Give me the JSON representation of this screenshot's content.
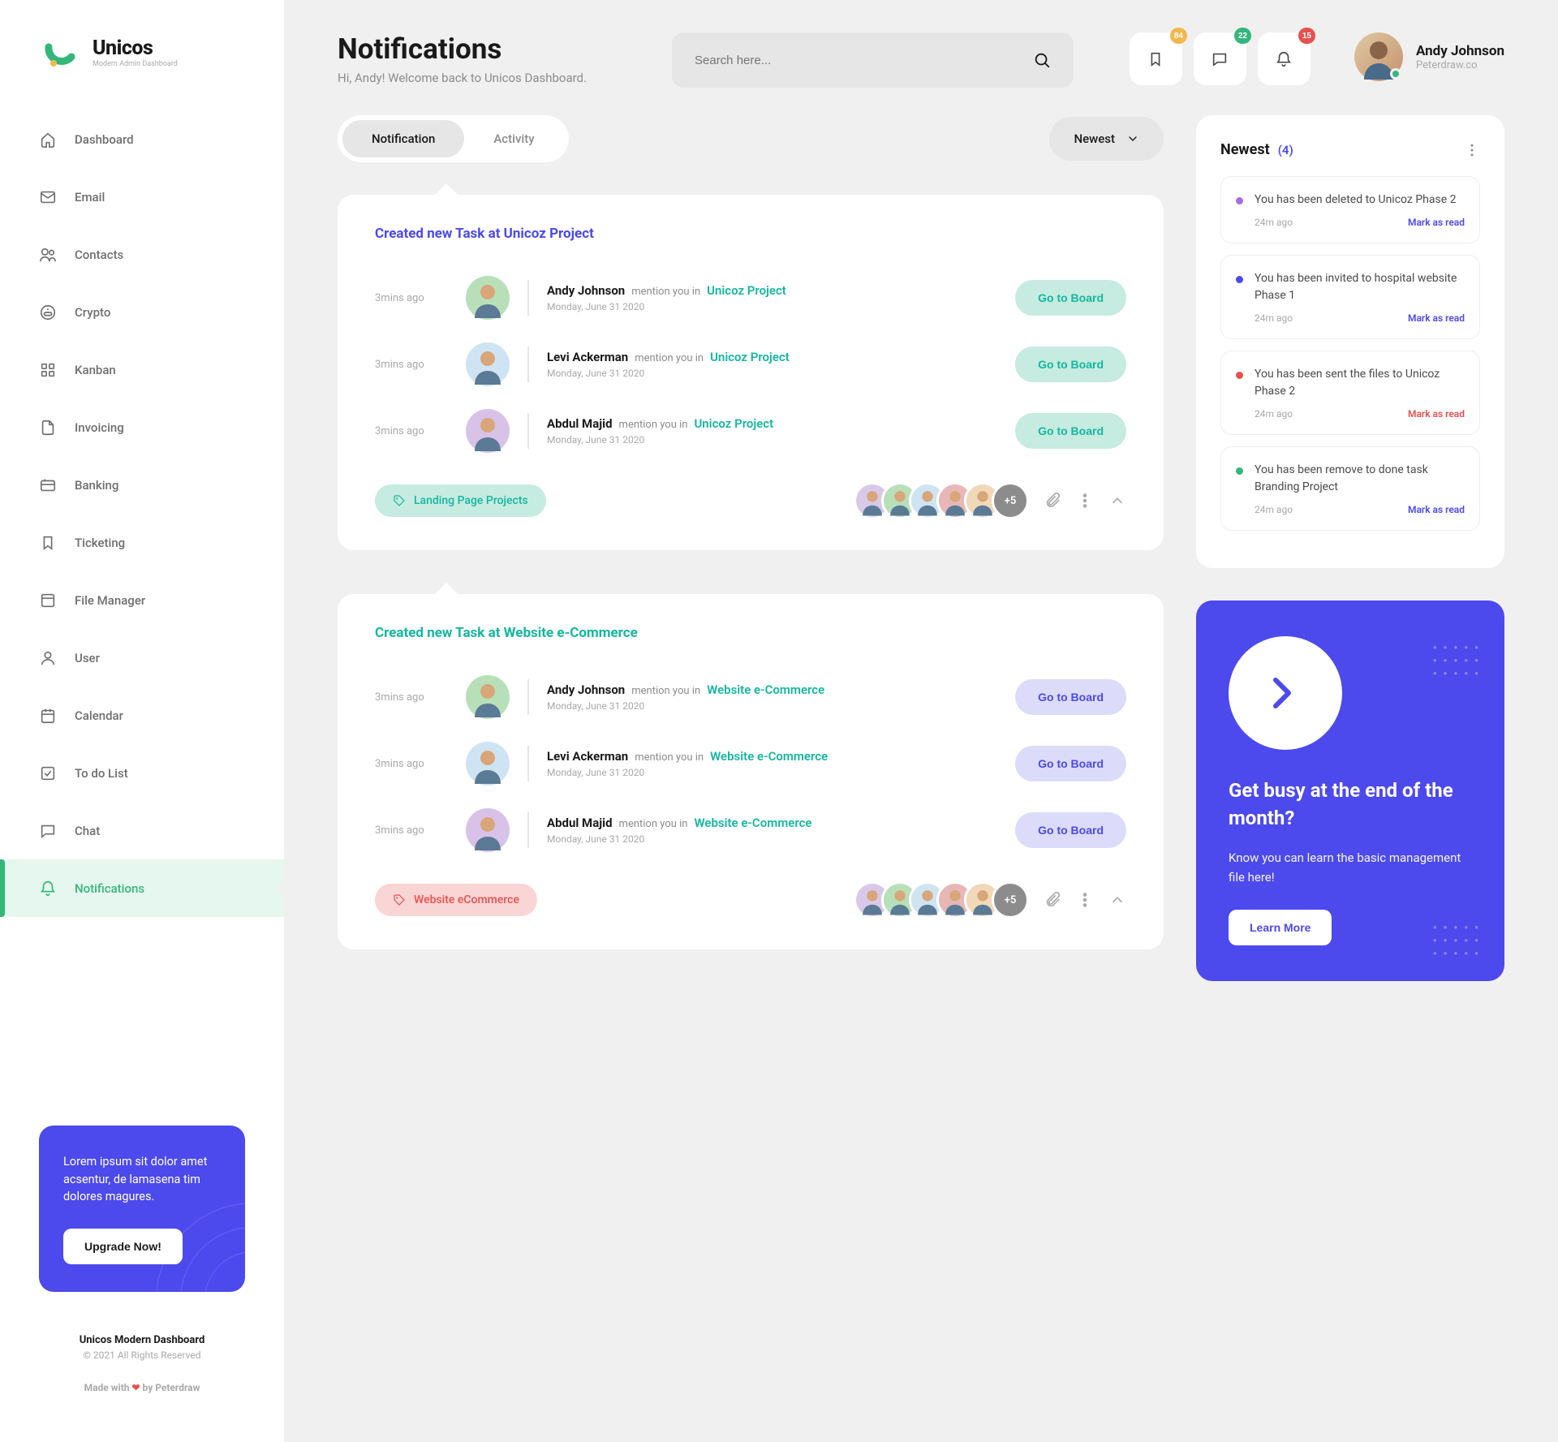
{
  "brand": {
    "name": "Unicos",
    "tagline": "Modern Admin Dashboard"
  },
  "header": {
    "title": "Notifications",
    "subtitle": "Hi, Andy! Welcome back to Unicos Dashboard.",
    "search_placeholder": "Search here..."
  },
  "badges": {
    "bookmark": "84",
    "chat": "22",
    "bell": "15"
  },
  "badge_colors": {
    "bookmark": "#F2B84B",
    "chat": "#33B77A",
    "bell": "#E94F4F"
  },
  "user": {
    "name": "Andy Johnson",
    "company": "Peterdraw.co"
  },
  "nav": [
    {
      "label": "Dashboard"
    },
    {
      "label": "Email"
    },
    {
      "label": "Contacts"
    },
    {
      "label": "Crypto"
    },
    {
      "label": "Kanban"
    },
    {
      "label": "Invoicing"
    },
    {
      "label": "Banking"
    },
    {
      "label": "Ticketing"
    },
    {
      "label": "File Manager"
    },
    {
      "label": "User"
    },
    {
      "label": "Calendar"
    },
    {
      "label": "To do List"
    },
    {
      "label": "Chat"
    },
    {
      "label": "Notifications"
    }
  ],
  "promo": {
    "text": "Lorem ipsum sit dolor amet acsentur, de lamasena tim dolores magures.",
    "button": "Upgrade Now!"
  },
  "footer": {
    "line1": "Unicos Modern Dashboard",
    "line2": "© 2021 All Rights Reserved",
    "made_pre": "Made with ",
    "made_post": " by Peterdraw"
  },
  "tabs": {
    "a": "Notification",
    "b": "Activity",
    "sort": "Newest"
  },
  "cards": [
    {
      "title": "Created new Task at Unicoz Project",
      "title_class": "",
      "tag": "Landing Page Projects",
      "tag_class": "teal",
      "btn_class": "teal",
      "proj_color": "#15B79E",
      "more_label": "+5",
      "rows": [
        {
          "time": "3mins ago",
          "name": "Andy Johnson",
          "mention": "mention you in",
          "project": "Unicoz Project",
          "date": "Monday, June 31 2020",
          "button": "Go to Board",
          "ava_bg": "#B7E0B8"
        },
        {
          "time": "3mins ago",
          "name": "Levi Ackerman",
          "mention": "mention you in",
          "project": "Unicoz Project",
          "date": "Monday, June 31 2020",
          "button": "Go to Board",
          "ava_bg": "#CFE4F2"
        },
        {
          "time": "3mins ago",
          "name": "Abdul Majid",
          "mention": "mention you in",
          "project": "Unicoz Project",
          "date": "Monday, June 31 2020",
          "button": "Go to Board",
          "ava_bg": "#D9C2E8"
        }
      ]
    },
    {
      "title": "Created new Task at Website e-Commerce",
      "title_class": "green",
      "tag": "Website eCommerce",
      "tag_class": "red",
      "btn_class": "purple",
      "proj_color": "#15B79E",
      "more_label": "+5",
      "rows": [
        {
          "time": "3mins ago",
          "name": "Andy Johnson",
          "mention": "mention you in",
          "project": "Website e-Commerce",
          "date": "Monday, June 31 2020",
          "button": "Go to Board",
          "ava_bg": "#B7E0B8"
        },
        {
          "time": "3mins ago",
          "name": "Levi Ackerman",
          "mention": "mention you in",
          "project": "Website e-Commerce",
          "date": "Monday, June 31 2020",
          "button": "Go to Board",
          "ava_bg": "#CFE4F2"
        },
        {
          "time": "3mins ago",
          "name": "Abdul Majid",
          "mention": "mention you in",
          "project": "Website e-Commerce",
          "date": "Monday, June 31 2020",
          "button": "Go to Board",
          "ava_bg": "#D9C2E8"
        }
      ]
    }
  ],
  "feed": {
    "title": "Newest",
    "count": "(4)",
    "items": [
      {
        "text": "You has been deleted to Unicoz Phase 2",
        "time": "24m ago",
        "mark": "Mark as read",
        "dot": "#A96BDF",
        "mark_class": ""
      },
      {
        "text": "You has been invited to hospital website Phase 1",
        "time": "24m ago",
        "mark": "Mark as read",
        "dot": "#4C49ED",
        "mark_class": ""
      },
      {
        "text": "You has been sent the files to Unicoz Phase 2",
        "time": "24m ago",
        "mark": "Mark as read",
        "dot": "#E94F4F",
        "mark_class": "red"
      },
      {
        "text": "You has been remove to done task Branding Project",
        "time": "24m ago",
        "mark": "Mark as read",
        "dot": "#33B77A",
        "mark_class": ""
      }
    ]
  },
  "banner": {
    "title": "Get busy at the end of the month?",
    "text": "Know you can learn the basic management file here!",
    "button": "Learn More"
  },
  "avatar_colors": [
    "#d9c8e8",
    "#b7e0b8",
    "#cfe4f2",
    "#e8b7b7",
    "#f0d8b8"
  ]
}
